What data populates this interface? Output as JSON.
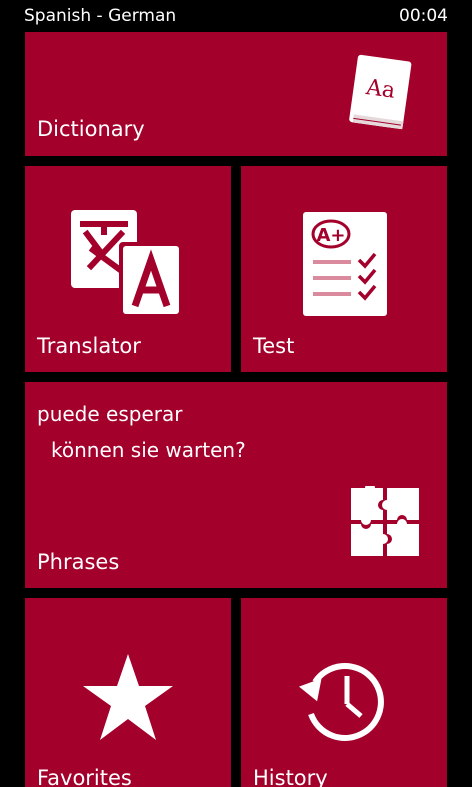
{
  "status_bar": {
    "title": "Spanish - German",
    "time": "00:04"
  },
  "colors": {
    "tile": "#a3002b",
    "background": "#000000",
    "foreground": "#ffffff"
  },
  "tiles": {
    "dictionary": {
      "label": "Dictionary",
      "icon": "dictionary-book-icon"
    },
    "translator": {
      "label": "Translator",
      "icon": "translate-icon"
    },
    "test": {
      "label": "Test",
      "icon": "test-checklist-icon"
    },
    "phrases": {
      "label": "Phrases",
      "icon": "puzzle-icon",
      "source_phrase": "puede esperar",
      "target_phrase": "können sie warten?"
    },
    "favorites": {
      "label": "Favorites",
      "icon": "star-icon"
    },
    "history": {
      "label": "History",
      "icon": "history-clock-icon"
    }
  }
}
